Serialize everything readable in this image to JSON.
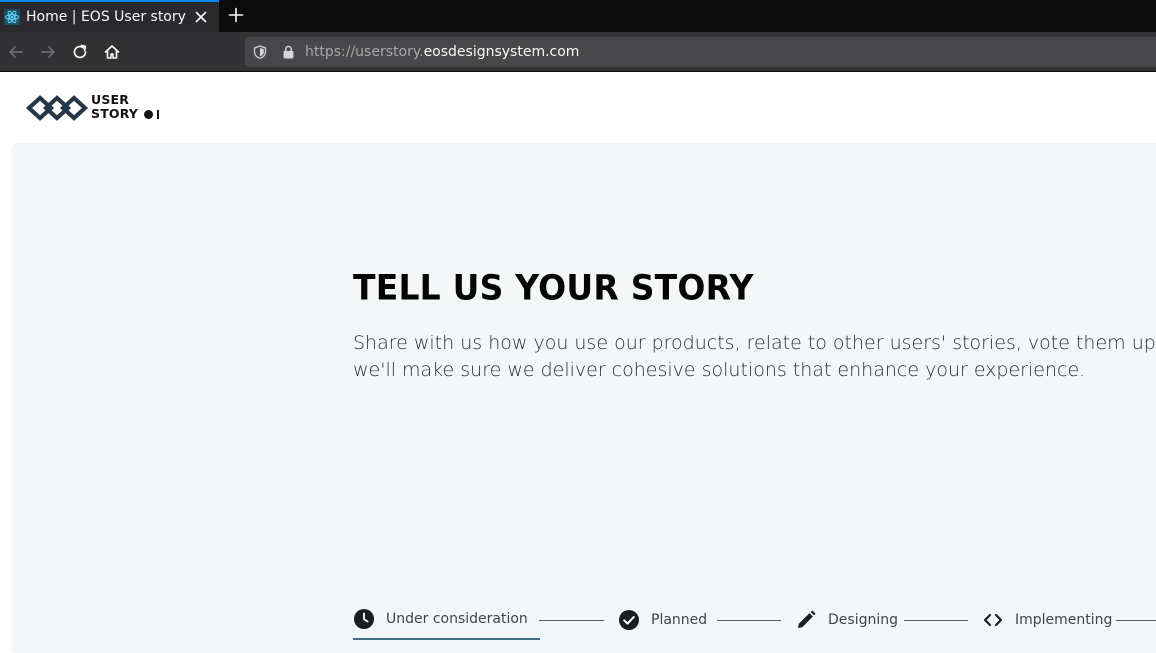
{
  "browser": {
    "tab_title": "Home | EOS User story",
    "url_prefix": "https://userstory.",
    "url_domain": "eosdesignsystem.com",
    "icons": [
      "react-favicon-icon",
      "close-icon",
      "plus-icon",
      "back-arrow-icon",
      "forward-arrow-icon",
      "reload-icon",
      "home-icon",
      "shield-icon",
      "lock-icon"
    ]
  },
  "header": {
    "logo_line1": "USER",
    "logo_line2": "STORY"
  },
  "hero": {
    "title": "TELL US YOUR STORY",
    "description": "Share with us how you use our products, relate to other users' stories, vote them up, an\nwe'll make sure we deliver cohesive solutions that enhance your experience."
  },
  "stepper": {
    "steps": [
      {
        "label": "Under consideration",
        "icon": "clock-icon",
        "active": true
      },
      {
        "label": "Planned",
        "icon": "check-circle-icon",
        "active": false
      },
      {
        "label": "Designing",
        "icon": "pencil-icon",
        "active": false
      },
      {
        "label": "Implementing",
        "icon": "code-icon",
        "active": false
      }
    ]
  },
  "colors": {
    "accent": "#3e6e8c",
    "hero_bg": "#f4f7f8",
    "title": "#050505",
    "chrome_dark": "#0c0c0d",
    "chrome_nav": "#323234"
  }
}
